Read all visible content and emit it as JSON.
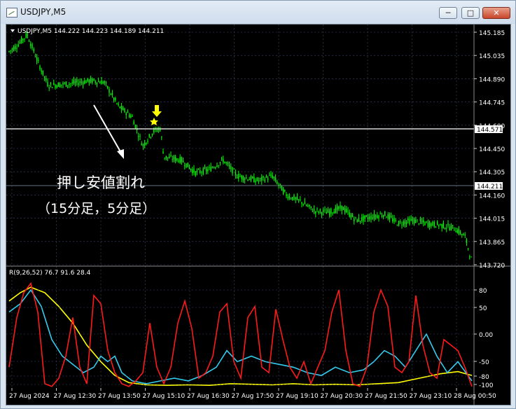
{
  "window": {
    "title": "USDJPY,M5",
    "buttons": {
      "minimize": "─",
      "maximize": "□",
      "close": "✕"
    }
  },
  "chart_header": {
    "symbol_line": "USDJPY,M5  144.222 144.223 144.189 144.211"
  },
  "price_axis": {
    "ticks": [
      "145.185",
      "145.035",
      "144.890",
      "144.745",
      "144.600",
      "144.450",
      "144.305",
      "144.160",
      "144.015",
      "143.865",
      "143.720"
    ],
    "hline_label": "144.571",
    "current_label": "144.211"
  },
  "annotation": {
    "line1": "押し安値割れ",
    "line2": "（15分足，5分足）",
    "arrow_color": "#ffff00",
    "star_color": "#ffff00"
  },
  "indicator": {
    "header": "R(9,26,52) 76.7 91.6 28.4",
    "ticks": [
      "80",
      "50",
      "0.00",
      "-50",
      "-80",
      "-100"
    ]
  },
  "time_axis": {
    "labels": [
      "27 Aug 2024",
      "27 Aug 12:30",
      "27 Aug 13:50",
      "27 Aug 15:10",
      "27 Aug 16:30",
      "27 Aug 17:50",
      "27 Aug 19:10",
      "27 Aug 20:30",
      "27 Aug 21:50",
      "27 Aug 23:10",
      "28 Aug 00:50"
    ]
  },
  "colors": {
    "candles": "#00ff00",
    "rsi_fast": "#ff1a1a",
    "rsi_mid": "#33ccee",
    "rsi_slow": "#ffff00",
    "grid": "#3d4a66",
    "background": "#000000"
  },
  "chart_data": {
    "type": "line",
    "series": [
      {
        "name": "USDJPY,M5",
        "x": [
          "27 Aug 2024",
          "27 Aug 12:30",
          "27 Aug 13:50",
          "27 Aug 15:10",
          "27 Aug 16:30",
          "27 Aug 17:50",
          "27 Aug 19:10",
          "27 Aug 20:30",
          "27 Aug 21:50",
          "27 Aug 23:10",
          "28 Aug 00:50"
        ],
        "values": [
          145.06,
          144.88,
          144.8,
          144.5,
          144.4,
          144.3,
          144.17,
          144.0,
          144.06,
          143.97,
          143.74
        ]
      }
    ],
    "ylim": [
      143.72,
      145.185
    ],
    "indicator_ylim": [
      -100,
      100
    ]
  }
}
